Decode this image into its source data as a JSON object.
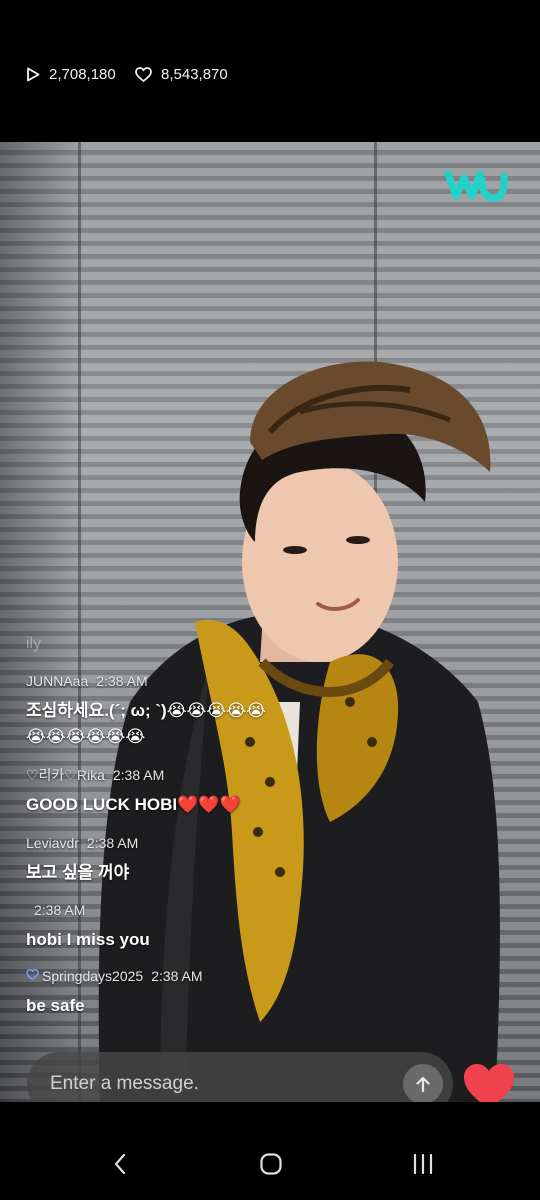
{
  "stats": {
    "views": "2,708,180",
    "likes": "8,543,870",
    "views_icon": "play-icon",
    "likes_icon": "heart-outline-icon"
  },
  "brand": {
    "logo_icon": "weverse-logo-icon",
    "accent": "#1fd3c9"
  },
  "chat": {
    "ghost_text": "ily",
    "messages": [
      {
        "user": "JUNNAaa",
        "time": "2:38 AM",
        "text_lines": [
          "조심하세요.(´; ω; `)😭😭😭😭😭",
          "😭😭😭😭😭😭"
        ]
      },
      {
        "user": "♡리카♡Rika",
        "time": "2:38 AM",
        "text_lines": [
          "GOOD LUCK HOBI❤️❤️❤️"
        ]
      },
      {
        "user": "Leviavdr",
        "time": "2:38 AM",
        "text_lines": [
          "보고 싶을 꺼야"
        ]
      },
      {
        "user": "",
        "time": "2:38 AM",
        "text_lines": [
          "hobi I miss you"
        ]
      },
      {
        "user": "Springdays2025",
        "time": "2:38 AM",
        "text_lines": [
          "be safe"
        ],
        "badge": "heart-badge-icon"
      }
    ]
  },
  "composer": {
    "placeholder": "Enter a message.",
    "send_icon": "arrow-up-icon",
    "heart_icon": "heart-icon",
    "heart_color": "#f0414d"
  },
  "nav": {
    "back_icon": "chevron-left-icon",
    "home_icon": "home-icon",
    "recents_icon": "recents-icon"
  }
}
